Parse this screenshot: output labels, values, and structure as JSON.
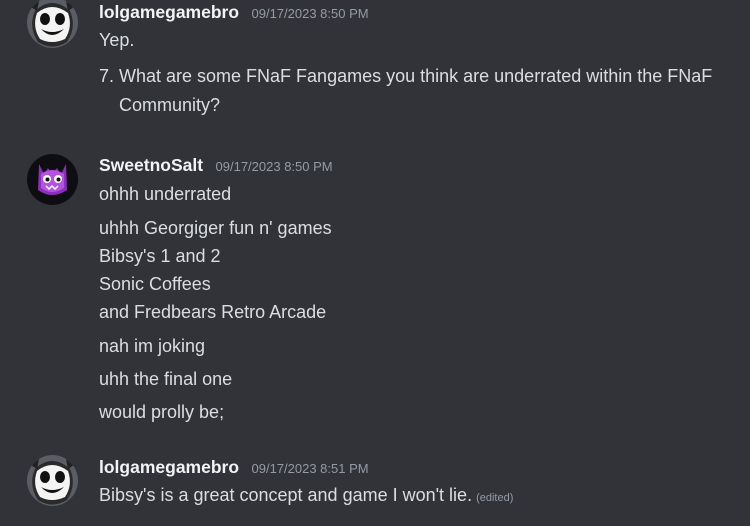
{
  "messages": [
    {
      "author": "lolgamegamebro",
      "timestamp": "09/17/2023 8:50 PM",
      "avatar_icon": "ghost-avatar-icon",
      "lines": [
        "Yep."
      ],
      "list_item": {
        "number": "7.",
        "text": "What are some FNaF Fangames you think are underrated within the FNaF Community?"
      }
    },
    {
      "author": "SweetnoSalt",
      "timestamp": "09/17/2023 8:50 PM",
      "avatar_icon": "purple-creature-avatar-icon",
      "lines": [
        "ohhh underrated",
        "uhhh Georgiger fun n' games",
        "Bibsy's 1 and 2",
        "Sonic Coffees",
        "and Fredbears Retro Arcade",
        "nah im joking",
        "uhh the final one",
        "would prolly be;"
      ]
    },
    {
      "author": "lolgamegamebro",
      "timestamp": "09/17/2023 8:51 PM",
      "avatar_icon": "ghost-avatar-icon",
      "lines": [
        "Bibsy's is a great concept and game I won't lie."
      ],
      "edited_label": "(edited)"
    }
  ],
  "colors": {
    "background": "#313338",
    "username": "#f2f3f5",
    "text": "#dbdee1",
    "muted": "#949ba4"
  }
}
